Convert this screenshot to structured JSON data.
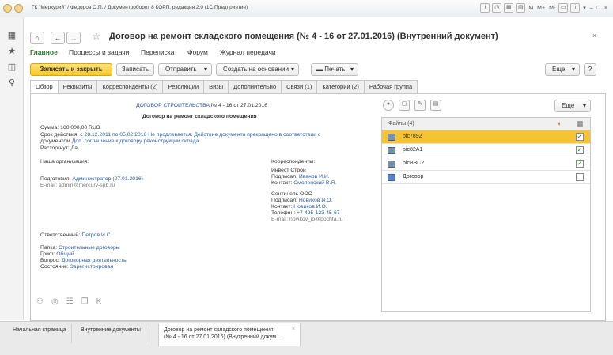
{
  "window": {
    "title": "ГК \"Меркурий\" / Федоров О.П. / Документооборот 8 КОРП, редакция 2.0 (1С:Предприятие)",
    "right_labels": [
      "M",
      "M+",
      "M-"
    ]
  },
  "header": {
    "home_icon": "⌂",
    "back_icon": "←",
    "forward_icon": "→",
    "star_icon": "☆",
    "title": "Договор на ремонт складского помещения (№ 4 - 16 от 27.01.2016) (Внутренний документ)",
    "close": "×"
  },
  "nav": {
    "items": [
      "Главное",
      "Процессы и задачи",
      "Переписка",
      "Форум",
      "Журнал передачи"
    ]
  },
  "toolbar": {
    "save_close": "Записать и закрыть",
    "save": "Записать",
    "send": "Отправить",
    "create_based": "Создать на основании",
    "print": "Печать",
    "more": "Еще",
    "help": "?"
  },
  "tabs": [
    "Обзор",
    "Реквизиты",
    "Корреспонденты (2)",
    "Резолюции",
    "Визы",
    "Дополнительно",
    "Связи (1)",
    "Категории (2)",
    "Рабочая группа"
  ],
  "overview": {
    "doc_link": "ДОГОВОР СТРОИТЕЛЬСТВА",
    "doc_number": "№ 4 - 16 от 27.01.2016",
    "doc_title": "Договор на ремонт складского помещения",
    "sum_label": "Сумма:",
    "sum_value": "160 000,00 RUB",
    "term_label": "Срок действия:",
    "term_value": "с 28.12.2011 по 05.02.2016 Не продлевается. Действие документа прекращено в соответствии с",
    "term_value2": "документом",
    "term_link2": "Доп. соглашение к договору реконструкции склада",
    "terminated_label": "Расторгнут:",
    "terminated_value": "Да",
    "our_org_label": "Наша организация:",
    "prepared_label": "Подготовил:",
    "prepared_value": "Администратор (27.01.2016)",
    "email_label": "E-mail:",
    "email_value": "admin@mercury-spb.ru",
    "corr_label": "Корреспонденты:",
    "corr1_name": "Инвест Строй",
    "corr1_signed_label": "Подписал:",
    "corr1_signed": "Иванов И.И.",
    "corr1_contact_label": "Контакт:",
    "corr1_contact": "Смоленский В.Я.",
    "corr2_name": "Сентинель ООО",
    "corr2_signed_label": "Подписал:",
    "corr2_signed": "Новиков И.О.",
    "corr2_contact_label": "Контакт:",
    "corr2_contact": "Новиков И.О.",
    "corr2_phone_label": "Телефон:",
    "corr2_phone": "+7-495-123-45-67",
    "corr2_email_label": "E-mail:",
    "corr2_email": "novikov_io@pochta.ru",
    "responsible_label": "Ответственный:",
    "responsible_value": "Петров И.С.",
    "folder_label": "Папка:",
    "folder_value": "Строительные договоры",
    "stamp_label": "Гриф:",
    "stamp_value": "Общий",
    "question_label": "Вопрос:",
    "question_value": "Договорная деятельность",
    "state_label": "Состояние:",
    "state_value": "Зарегистрирован"
  },
  "files": {
    "more": "Еще",
    "header": "Файлы (4)",
    "rows": [
      {
        "name": "pic7892",
        "checked": true
      },
      {
        "name": "pic82A1",
        "checked": true
      },
      {
        "name": "picBBC2",
        "checked": true
      },
      {
        "name": "Договор",
        "checked": false
      }
    ]
  },
  "bottom_tabs": {
    "home": "Начальная страница",
    "internal": "Внутренние документы",
    "current_line1": "Договор на ремонт складского помещения",
    "current_line2": "(№ 4 - 16 от 27.01.2016) (Внутренний докум..."
  }
}
